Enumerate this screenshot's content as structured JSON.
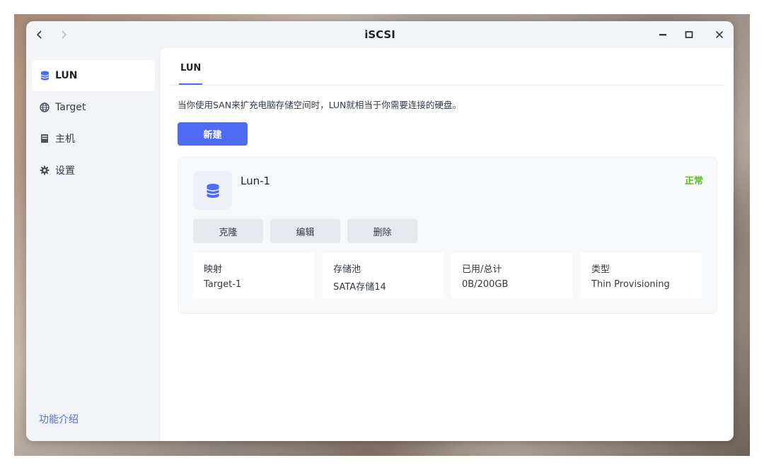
{
  "window": {
    "title": "iSCSI",
    "nav_back": "<",
    "nav_forward": ">"
  },
  "sidebar": {
    "items": [
      {
        "label": "LUN",
        "icon": "database-icon",
        "active": true
      },
      {
        "label": "Target",
        "icon": "globe-icon",
        "active": false
      },
      {
        "label": "主机",
        "icon": "server-icon",
        "active": false
      },
      {
        "label": "设置",
        "icon": "gear-icon",
        "active": false
      }
    ],
    "footer_link": "功能介绍"
  },
  "tabs": [
    {
      "label": "LUN",
      "active": true
    }
  ],
  "description": "当你使用SAN来扩充电脑存储空间时，LUN就相当于你需要连接的硬盘。",
  "new_button": "新建",
  "lun": {
    "name": "Lun-1",
    "status": "正常",
    "icon": "database-icon",
    "actions": {
      "clone": "克隆",
      "edit": "编辑",
      "delete": "删除"
    },
    "info": [
      {
        "label": "映射",
        "value": "Target-1"
      },
      {
        "label": "存储池",
        "value": "SATA存储14"
      },
      {
        "label": "已用/总计",
        "value": "0B/200GB"
      },
      {
        "label": "类型",
        "value": "Thin Provisioning"
      }
    ]
  },
  "colors": {
    "accent": "#4d6bf5",
    "status_ok": "#52c41a",
    "sidebar_bg": "#f3f4f8",
    "card_bg": "#f7f8fa"
  }
}
